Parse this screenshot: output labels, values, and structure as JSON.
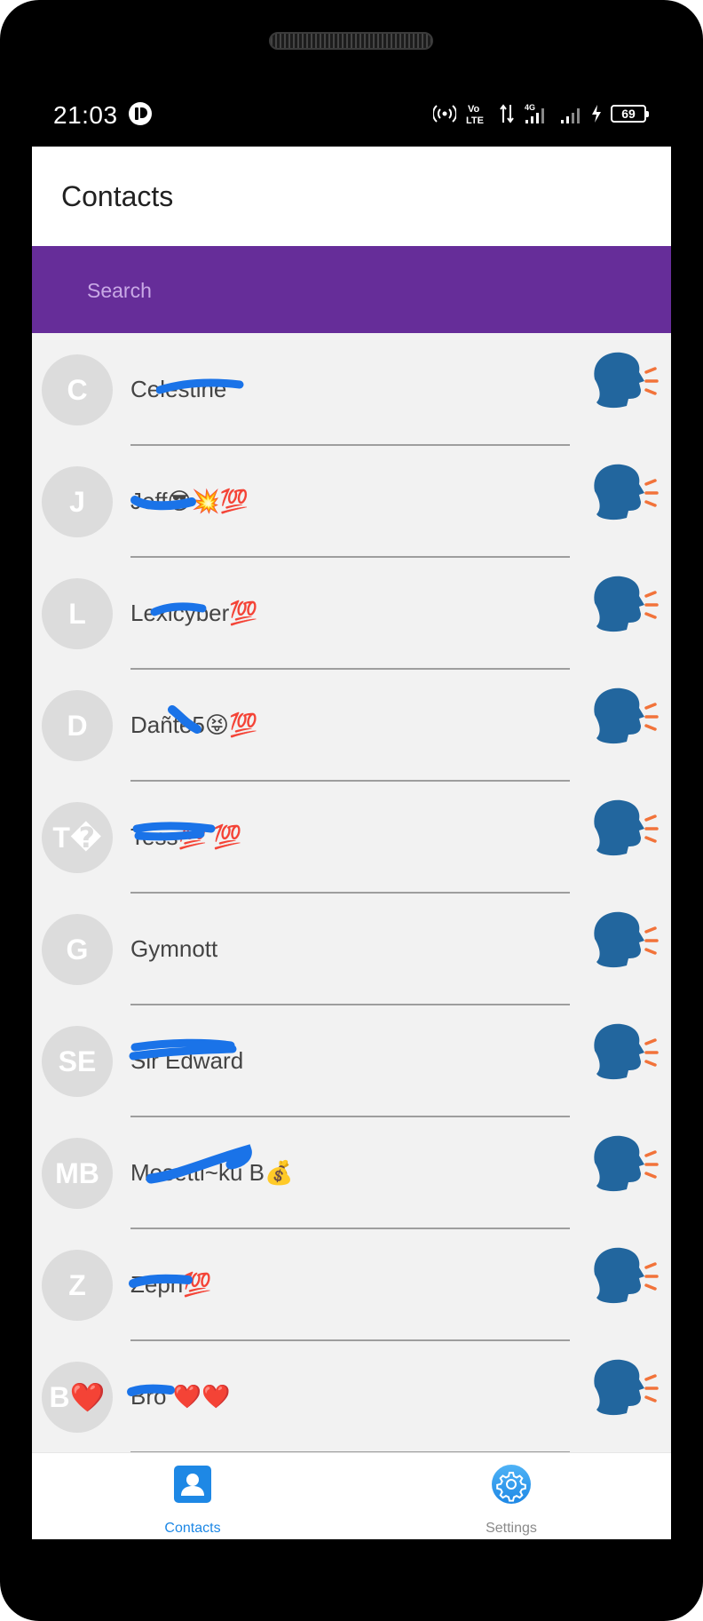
{
  "status_bar": {
    "time": "21:03",
    "battery": "69",
    "icons": [
      "hotspot-icon",
      "volte-icon",
      "data-arrows-icon",
      "signal-4g-icon",
      "signal-icon",
      "charging-icon"
    ]
  },
  "app": {
    "title": "Contacts"
  },
  "search": {
    "placeholder": "Search",
    "value": ""
  },
  "colors": {
    "accent": "#662d99",
    "speak_icon": "#22669e",
    "speak_waves": "#f2733a",
    "nav_active": "#1e88e5"
  },
  "contacts": [
    {
      "initials": "C",
      "name": "Celestine"
    },
    {
      "initials": "J",
      "name": "Jeff😎💥💯"
    },
    {
      "initials": "L",
      "name": "Lexicyber💯"
    },
    {
      "initials": "D",
      "name": "Dañte5😝💯"
    },
    {
      "initials": "T�",
      "name": "Tess💯 💯"
    },
    {
      "initials": "G",
      "name": "Gymnott"
    },
    {
      "initials": "SE",
      "name": "Sir Edward"
    },
    {
      "initials": "MB",
      "name": "Mosetti~ku B💰"
    },
    {
      "initials": "Z",
      "name": "Zeph💯"
    },
    {
      "initials": "B❤️",
      "name": "Bro ❤️❤️"
    }
  ],
  "bottom_nav": {
    "items": [
      {
        "label": "Contacts",
        "icon": "contacts-icon",
        "active": true
      },
      {
        "label": "Settings",
        "icon": "settings-icon",
        "active": false
      }
    ]
  }
}
